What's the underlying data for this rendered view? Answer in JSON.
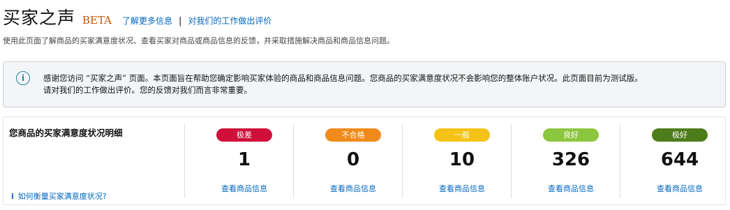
{
  "header": {
    "title": "买家之声",
    "beta": "BETA",
    "learn_more": "了解更多信息",
    "separator": "|",
    "rate_work": "对我们的工作做出评价"
  },
  "subtitle": "使用此页面了解商品的买家满意度状况、查看买家对商品或商品信息的反馈，并采取措施解决商品和商品信息问题。",
  "notice": {
    "icon": "info-icon",
    "line1": "感谢您访问 “买家之声” 页面。本页面旨在帮助您确定影响买家体验的商品和商品信息问题。您商品的买家满意度状况不会影响您的整体账户状况。此页面目前为测试版。",
    "line2": "请对我们的工作做出评价。您的反馈对我们而言非常重要。"
  },
  "panel": {
    "title": "您商品的买家满意度状况明细",
    "help_icon": "i",
    "help_link": "如何衡量买家满意度状况?",
    "ratings": [
      {
        "label": "极差",
        "count": "1",
        "link": "查看商品信息",
        "color": "#d0103a"
      },
      {
        "label": "不合格",
        "count": "0",
        "link": "查看商品信息",
        "color": "#f08a1a"
      },
      {
        "label": "一般",
        "count": "10",
        "link": "查看商品信息",
        "color": "#f5c315"
      },
      {
        "label": "良好",
        "count": "326",
        "link": "查看商品信息",
        "color": "#8cc63e"
      },
      {
        "label": "极好",
        "count": "644",
        "link": "查看商品信息",
        "color": "#4d7c1b"
      }
    ]
  }
}
